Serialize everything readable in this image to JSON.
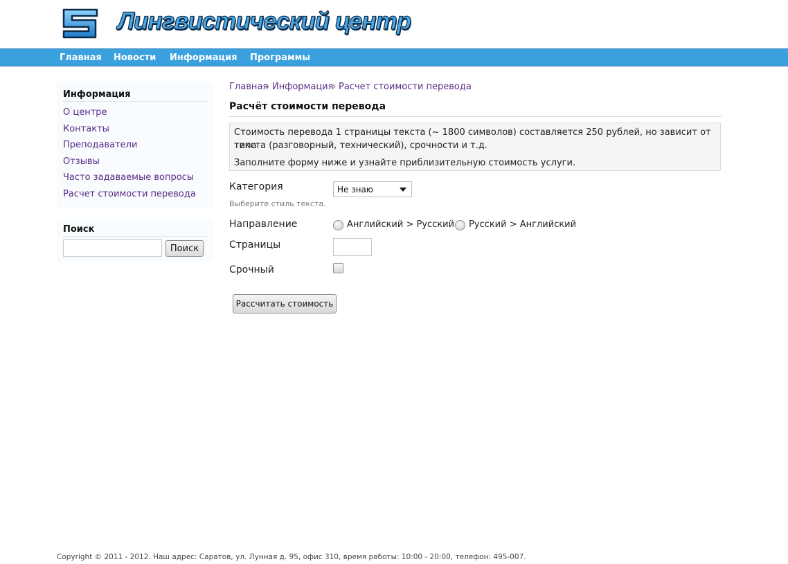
{
  "header": {
    "site_title": "Лингвистический центр",
    "logo_icon": "stylized-s-logo-icon"
  },
  "nav": {
    "items": [
      {
        "label": "Главная"
      },
      {
        "label": "Новости"
      },
      {
        "label": "Информация"
      },
      {
        "label": "Программы"
      }
    ]
  },
  "sidebar": {
    "info_heading": "Информация",
    "links": [
      {
        "label": "О центре"
      },
      {
        "label": "Контакты"
      },
      {
        "label": "Преподаватели"
      },
      {
        "label": "Отзывы"
      },
      {
        "label": "Часто задаваемые вопросы"
      },
      {
        "label": "Расчет стоимости перевода"
      }
    ],
    "search_heading": "Поиск",
    "search_value": "",
    "search_button": "Поиск"
  },
  "breadcrumb": {
    "items": [
      "Главная",
      "Информация",
      "Расчет стоимости перевода"
    ],
    "separator": "›"
  },
  "main": {
    "title": "Расчёт стоимости перевода",
    "info_line1": "Стоимость перевода 1 страницы текста (~ 1800 символов) составляется 250 рублей, но зависит от типа",
    "info_line2": "текста (разговорный, технический), срочности и т.д.",
    "info_line3": "Заполните форму ниже и узнайте приблизительную стоимость услуги."
  },
  "form": {
    "category_label": "Категория",
    "category_value": "Не знаю",
    "category_hint": "Выберите стиль текста.",
    "direction_label": "Направление",
    "direction_options": [
      "Английский > Русский",
      "Русский > Английский"
    ],
    "pages_label": "Страницы",
    "pages_value": "",
    "urgent_label": "Срочный",
    "urgent_checked": false,
    "submit_label": "Рассчитать стоимость"
  },
  "footer": {
    "text": "Copyright © 2011 - 2012. Наш адрес: Саратов, ул. Лунная д. 95, офис 310, время работы: 10:00 - 20:00, телефон: 495-007."
  },
  "colors": {
    "nav_background": "#3aa0de",
    "link_color": "#5b2a86",
    "title_fill": "#4aa8e6"
  }
}
